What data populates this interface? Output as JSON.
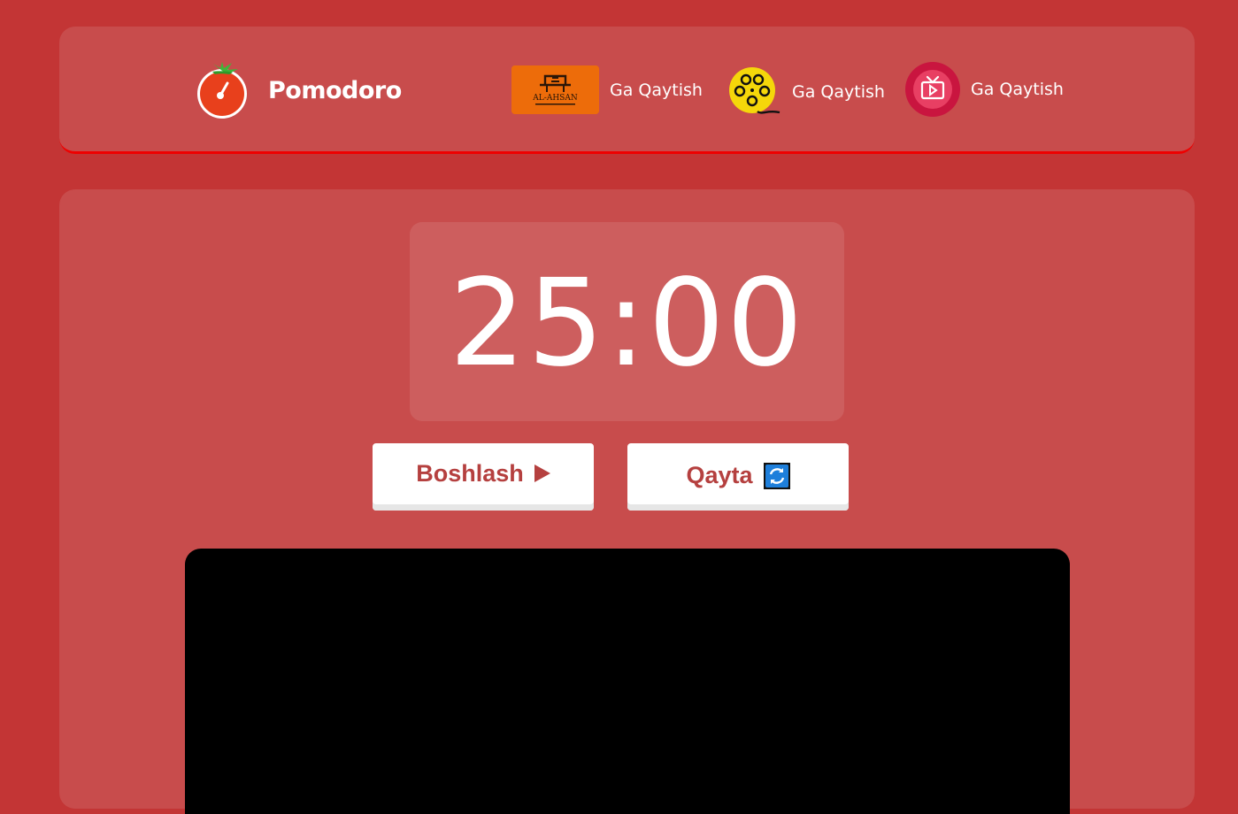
{
  "header": {
    "brand_title": "Pomodoro",
    "nav": [
      {
        "label": "Ga Qaytish",
        "logo": "al-ahsan-logo",
        "logo_text": "AL-AHSAN"
      },
      {
        "label": "Ga Qaytish",
        "logo": "film-reel-logo"
      },
      {
        "label": "Ga Qaytish",
        "logo": "tv-play-logo"
      }
    ]
  },
  "timer": {
    "display": "25:00",
    "minutes": 25,
    "seconds": 0
  },
  "controls": {
    "start_label": "Boshlash",
    "start_icon": "play-icon",
    "reset_label": "Qayta",
    "reset_icon": "refresh-icon"
  },
  "video": {
    "state": "black"
  },
  "colors": {
    "page_background": "#c33535",
    "panel_background": "#c84c4c",
    "timer_background": "#cd5e5e",
    "header_border": "#ee0000",
    "button_text": "#b5403f",
    "button_background": "#ffffff",
    "video_background": "#000000"
  }
}
